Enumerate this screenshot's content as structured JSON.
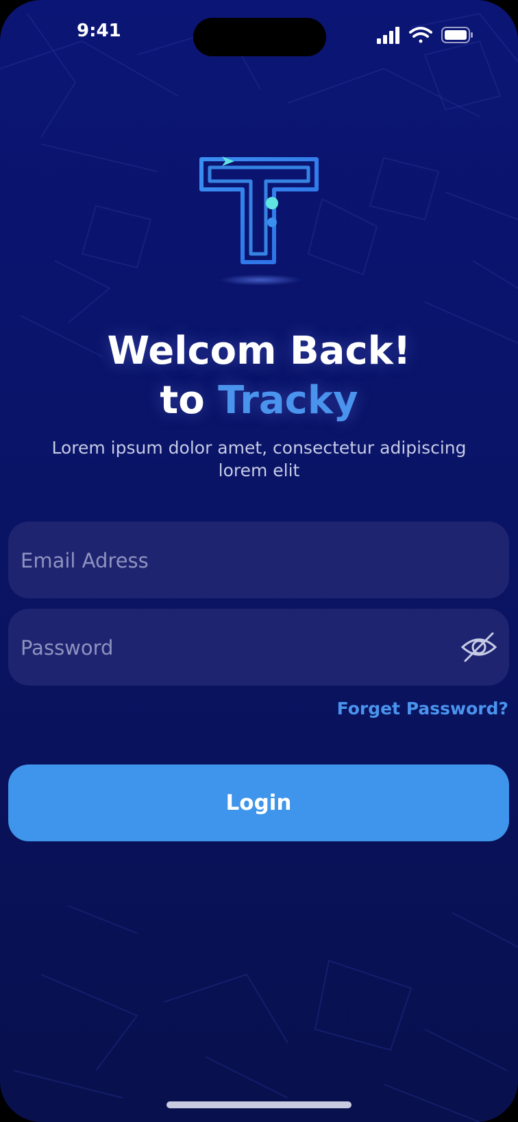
{
  "status_bar": {
    "time": "9:41",
    "signal_icon": "cellular-signal-icon",
    "wifi_icon": "wifi-icon",
    "battery_icon": "battery-icon"
  },
  "logo": {
    "icon": "tracky-t-logo",
    "colors": [
      "#3a8ff0",
      "#5fe6e0"
    ]
  },
  "headline": {
    "line1": "Welcom Back!",
    "line2_prefix": "to ",
    "brand": "Tracky"
  },
  "subtitle": "Lorem ipsum dolor amet, consectetur adipiscing lorem elit",
  "form": {
    "email": {
      "value": "",
      "placeholder": "Email Adress"
    },
    "password": {
      "value": "",
      "placeholder": "Password",
      "toggle_icon": "eye-slash-icon"
    },
    "forgot_label": "Forget Password?",
    "login_label": "Login"
  },
  "colors": {
    "background": "#0a1466",
    "field": "#1e2470",
    "accent": "#3f95eb",
    "brand_text": "#4a94ee"
  }
}
